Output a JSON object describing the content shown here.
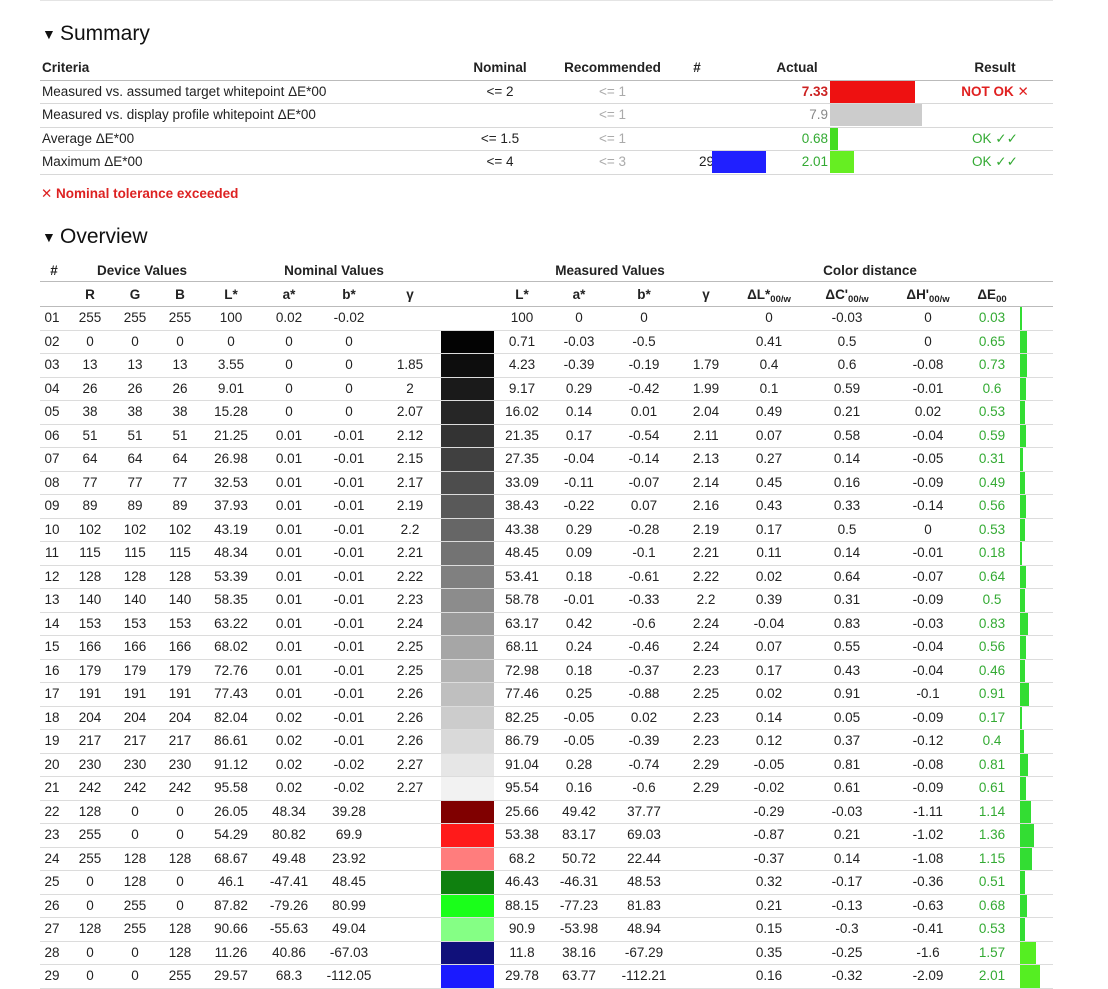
{
  "summary": {
    "title": "Summary",
    "headers": {
      "criteria": "Criteria",
      "nominal": "Nominal",
      "recommended": "Recommended",
      "num": "#",
      "actual": "Actual",
      "result": "Result"
    },
    "rows": [
      {
        "criteria": "Measured vs. assumed target whitepoint ΔE*00",
        "nominal": "<= 2",
        "recommended": "<= 1",
        "num": "",
        "actual": "7.33",
        "result": "NOT OK ✕",
        "status": "fail",
        "bar_color": "#ee1111",
        "bar_fraction": 0.85
      },
      {
        "criteria": "Measured vs. display profile whitepoint ΔE*00",
        "nominal": "",
        "recommended": "<= 1",
        "num": "",
        "actual": "7.9",
        "result": "",
        "status": "info",
        "bar_color": "#cccccc",
        "bar_fraction": 0.92
      },
      {
        "criteria": "Average ΔE*00",
        "nominal": "<= 1.5",
        "recommended": "<= 1",
        "num": "",
        "actual": "0.68",
        "result": "OK ✓✓",
        "status": "pass",
        "bar_color": "#44dd22",
        "bar_fraction": 0.08
      },
      {
        "criteria": "Maximum ΔE*00",
        "nominal": "<= 4",
        "recommended": "<= 3",
        "num": "29",
        "actual": "2.01",
        "result": "OK ✓✓",
        "status": "pass",
        "bar_color": "#66ee22",
        "bar_fraction": 0.24,
        "swatch": "#2020ff"
      }
    ],
    "tolerance_message": "✕ Nominal tolerance exceeded"
  },
  "overview": {
    "title": "Overview",
    "group_headers": {
      "num": "#",
      "device": "Device Values",
      "nominal": "Nominal Values",
      "measured": "Measured Values",
      "distance": "Color distance"
    },
    "columns": {
      "R": "R",
      "G": "G",
      "B": "B",
      "L": "L*",
      "a": "a*",
      "b": "b*",
      "gamma": "γ",
      "mL": "L*",
      "ma": "a*",
      "mb": "b*",
      "mgamma": "γ",
      "dL": "ΔL*",
      "dC": "ΔC'",
      "dH": "ΔH'",
      "dE": "ΔE",
      "sub_w": "00/w",
      "sub_00": "00"
    },
    "rows": [
      [
        "01",
        "255",
        "255",
        "255",
        "100",
        "0.02",
        "-0.02",
        "",
        "100",
        "0",
        "0",
        "",
        "0",
        "-0.03",
        "0",
        "0.03",
        "#ffffff"
      ],
      [
        "02",
        "0",
        "0",
        "0",
        "0",
        "0",
        "0",
        "",
        "0.71",
        "-0.03",
        "-0.5",
        "",
        "0.41",
        "0.5",
        "0",
        "0.65",
        "#030303"
      ],
      [
        "03",
        "13",
        "13",
        "13",
        "3.55",
        "0",
        "0",
        "1.85",
        "4.23",
        "-0.39",
        "-0.19",
        "1.79",
        "0.4",
        "0.6",
        "-0.08",
        "0.73",
        "#0d0d0d"
      ],
      [
        "04",
        "26",
        "26",
        "26",
        "9.01",
        "0",
        "0",
        "2",
        "9.17",
        "0.29",
        "-0.42",
        "1.99",
        "0.1",
        "0.59",
        "-0.01",
        "0.6",
        "#1a1a1a"
      ],
      [
        "05",
        "38",
        "38",
        "38",
        "15.28",
        "0",
        "0",
        "2.07",
        "16.02",
        "0.14",
        "0.01",
        "2.04",
        "0.49",
        "0.21",
        "0.02",
        "0.53",
        "#262626"
      ],
      [
        "06",
        "51",
        "51",
        "51",
        "21.25",
        "0.01",
        "-0.01",
        "2.12",
        "21.35",
        "0.17",
        "-0.54",
        "2.11",
        "0.07",
        "0.58",
        "-0.04",
        "0.59",
        "#333333"
      ],
      [
        "07",
        "64",
        "64",
        "64",
        "26.98",
        "0.01",
        "-0.01",
        "2.15",
        "27.35",
        "-0.04",
        "-0.14",
        "2.13",
        "0.27",
        "0.14",
        "-0.05",
        "0.31",
        "#404040"
      ],
      [
        "08",
        "77",
        "77",
        "77",
        "32.53",
        "0.01",
        "-0.01",
        "2.17",
        "33.09",
        "-0.11",
        "-0.07",
        "2.14",
        "0.45",
        "0.16",
        "-0.09",
        "0.49",
        "#4d4d4d"
      ],
      [
        "09",
        "89",
        "89",
        "89",
        "37.93",
        "0.01",
        "-0.01",
        "2.19",
        "38.43",
        "-0.22",
        "0.07",
        "2.16",
        "0.43",
        "0.33",
        "-0.14",
        "0.56",
        "#595959"
      ],
      [
        "10",
        "102",
        "102",
        "102",
        "43.19",
        "0.01",
        "-0.01",
        "2.2",
        "43.38",
        "0.29",
        "-0.28",
        "2.19",
        "0.17",
        "0.5",
        "0",
        "0.53",
        "#666666"
      ],
      [
        "11",
        "115",
        "115",
        "115",
        "48.34",
        "0.01",
        "-0.01",
        "2.21",
        "48.45",
        "0.09",
        "-0.1",
        "2.21",
        "0.11",
        "0.14",
        "-0.01",
        "0.18",
        "#737373"
      ],
      [
        "12",
        "128",
        "128",
        "128",
        "53.39",
        "0.01",
        "-0.01",
        "2.22",
        "53.41",
        "0.18",
        "-0.61",
        "2.22",
        "0.02",
        "0.64",
        "-0.07",
        "0.64",
        "#808080"
      ],
      [
        "13",
        "140",
        "140",
        "140",
        "58.35",
        "0.01",
        "-0.01",
        "2.23",
        "58.78",
        "-0.01",
        "-0.33",
        "2.2",
        "0.39",
        "0.31",
        "-0.09",
        "0.5",
        "#8c8c8c"
      ],
      [
        "14",
        "153",
        "153",
        "153",
        "63.22",
        "0.01",
        "-0.01",
        "2.24",
        "63.17",
        "0.42",
        "-0.6",
        "2.24",
        "-0.04",
        "0.83",
        "-0.03",
        "0.83",
        "#999999"
      ],
      [
        "15",
        "166",
        "166",
        "166",
        "68.02",
        "0.01",
        "-0.01",
        "2.25",
        "68.11",
        "0.24",
        "-0.46",
        "2.24",
        "0.07",
        "0.55",
        "-0.04",
        "0.56",
        "#a6a6a6"
      ],
      [
        "16",
        "179",
        "179",
        "179",
        "72.76",
        "0.01",
        "-0.01",
        "2.25",
        "72.98",
        "0.18",
        "-0.37",
        "2.23",
        "0.17",
        "0.43",
        "-0.04",
        "0.46",
        "#b3b3b3"
      ],
      [
        "17",
        "191",
        "191",
        "191",
        "77.43",
        "0.01",
        "-0.01",
        "2.26",
        "77.46",
        "0.25",
        "-0.88",
        "2.25",
        "0.02",
        "0.91",
        "-0.1",
        "0.91",
        "#bfbfbf"
      ],
      [
        "18",
        "204",
        "204",
        "204",
        "82.04",
        "0.02",
        "-0.01",
        "2.26",
        "82.25",
        "-0.05",
        "0.02",
        "2.23",
        "0.14",
        "0.05",
        "-0.09",
        "0.17",
        "#cccccc"
      ],
      [
        "19",
        "217",
        "217",
        "217",
        "86.61",
        "0.02",
        "-0.01",
        "2.26",
        "86.79",
        "-0.05",
        "-0.39",
        "2.23",
        "0.12",
        "0.37",
        "-0.12",
        "0.4",
        "#d9d9d9"
      ],
      [
        "20",
        "230",
        "230",
        "230",
        "91.12",
        "0.02",
        "-0.02",
        "2.27",
        "91.04",
        "0.28",
        "-0.74",
        "2.29",
        "-0.05",
        "0.81",
        "-0.08",
        "0.81",
        "#e6e6e6"
      ],
      [
        "21",
        "242",
        "242",
        "242",
        "95.58",
        "0.02",
        "-0.02",
        "2.27",
        "95.54",
        "0.16",
        "-0.6",
        "2.29",
        "-0.02",
        "0.61",
        "-0.09",
        "0.61",
        "#f2f2f2"
      ],
      [
        "22",
        "128",
        "0",
        "0",
        "26.05",
        "48.34",
        "39.28",
        "",
        "25.66",
        "49.42",
        "37.77",
        "",
        "-0.29",
        "-0.03",
        "-1.11",
        "1.14",
        "#800000"
      ],
      [
        "23",
        "255",
        "0",
        "0",
        "54.29",
        "80.82",
        "69.9",
        "",
        "53.38",
        "83.17",
        "69.03",
        "",
        "-0.87",
        "0.21",
        "-1.02",
        "1.36",
        "#ff1a1a"
      ],
      [
        "24",
        "255",
        "128",
        "128",
        "68.67",
        "49.48",
        "23.92",
        "",
        "68.2",
        "50.72",
        "22.44",
        "",
        "-0.37",
        "0.14",
        "-1.08",
        "1.15",
        "#ff7d7d"
      ],
      [
        "25",
        "0",
        "128",
        "0",
        "46.1",
        "-47.41",
        "48.45",
        "",
        "46.43",
        "-46.31",
        "48.53",
        "",
        "0.32",
        "-0.17",
        "-0.36",
        "0.51",
        "#0f800f"
      ],
      [
        "26",
        "0",
        "255",
        "0",
        "87.82",
        "-79.26",
        "80.99",
        "",
        "88.15",
        "-77.23",
        "81.83",
        "",
        "0.21",
        "-0.13",
        "-0.63",
        "0.68",
        "#1aff1a"
      ],
      [
        "27",
        "128",
        "255",
        "128",
        "90.66",
        "-55.63",
        "49.04",
        "",
        "90.9",
        "-53.98",
        "48.94",
        "",
        "0.15",
        "-0.3",
        "-0.41",
        "0.53",
        "#85ff85"
      ],
      [
        "28",
        "0",
        "0",
        "128",
        "11.26",
        "40.86",
        "-67.03",
        "",
        "11.8",
        "38.16",
        "-67.29",
        "",
        "0.35",
        "-0.25",
        "-1.6",
        "1.57",
        "#10107a"
      ],
      [
        "29",
        "0",
        "0",
        "255",
        "29.57",
        "68.3",
        "-112.05",
        "",
        "29.78",
        "63.77",
        "-112.21",
        "",
        "0.16",
        "-0.32",
        "-2.09",
        "2.01",
        "#1a1aff"
      ]
    ]
  }
}
